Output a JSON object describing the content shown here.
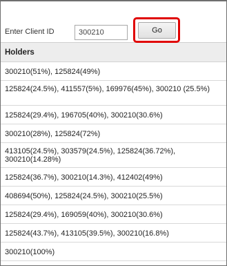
{
  "search": {
    "label": "Enter Client ID",
    "client_id_value": "300210",
    "go_label": "Go"
  },
  "table": {
    "header": "Holders",
    "rows": [
      "300210(51%), 125824(49%)",
      "125824(24.5%), 411557(5%), 169976(45%), 300210 (25.5%)",
      "125824(29.4%), 196705(40%), 300210(30.6%)",
      "300210(28%), 125824(72%)",
      "413105(24.5%), 303579(24.5%), 125824(36.72%), 300210(14.28%)",
      "125824(36.7%), 300210(14.3%), 412402(49%)",
      "408694(50%), 125824(24.5%), 300210(25.5%)",
      "125824(29.4%), 169059(40%), 300210(30.6%)",
      "125824(43.7%), 413105(39.5%), 300210(16.8%)",
      "300210(100%)"
    ]
  },
  "colors": {
    "highlight": "#e00000",
    "header_bg": "#ededed"
  }
}
